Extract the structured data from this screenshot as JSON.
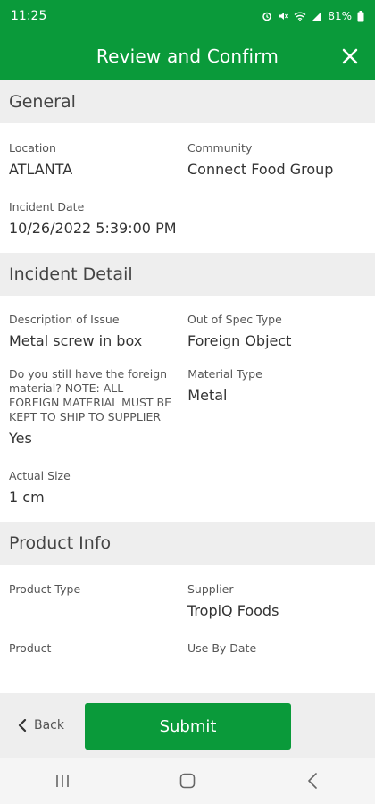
{
  "status_bar": {
    "time": "11:25",
    "battery": "81%"
  },
  "app_bar": {
    "title": "Review and Confirm",
    "close_icon": "close-icon"
  },
  "sections": {
    "general": {
      "title": "General",
      "location_label": "Location",
      "location_value": "ATLANTA",
      "community_label": "Community",
      "community_value": "Connect Food Group",
      "incident_date_label": "Incident Date",
      "incident_date_value": "10/26/2022 5:39:00 PM"
    },
    "incident_detail": {
      "title": "Incident Detail",
      "description_label": "Description of Issue",
      "description_value": "Metal screw in box",
      "out_of_spec_label": "Out of Spec Type",
      "out_of_spec_value": "Foreign Object",
      "foreign_material_label": "Do you still have the foreign material?  NOTE: ALL FOREIGN MATERIAL MUST BE KEPT TO SHIP TO SUPPLIER",
      "foreign_material_value": "Yes",
      "material_type_label": "Material Type",
      "material_type_value": "Metal",
      "actual_size_label": "Actual Size",
      "actual_size_value": "1 cm"
    },
    "product_info": {
      "title": "Product Info",
      "product_type_label": "Product Type",
      "product_type_value": "",
      "supplier_label": "Supplier",
      "supplier_value": "TropiQ Foods",
      "product_label": "Product",
      "use_by_date_label": "Use By Date"
    }
  },
  "bottom_bar": {
    "back_label": "Back",
    "submit_label": "Submit"
  },
  "colors": {
    "brand_green": "#0a9a3a",
    "section_bg": "#eeeeee"
  }
}
